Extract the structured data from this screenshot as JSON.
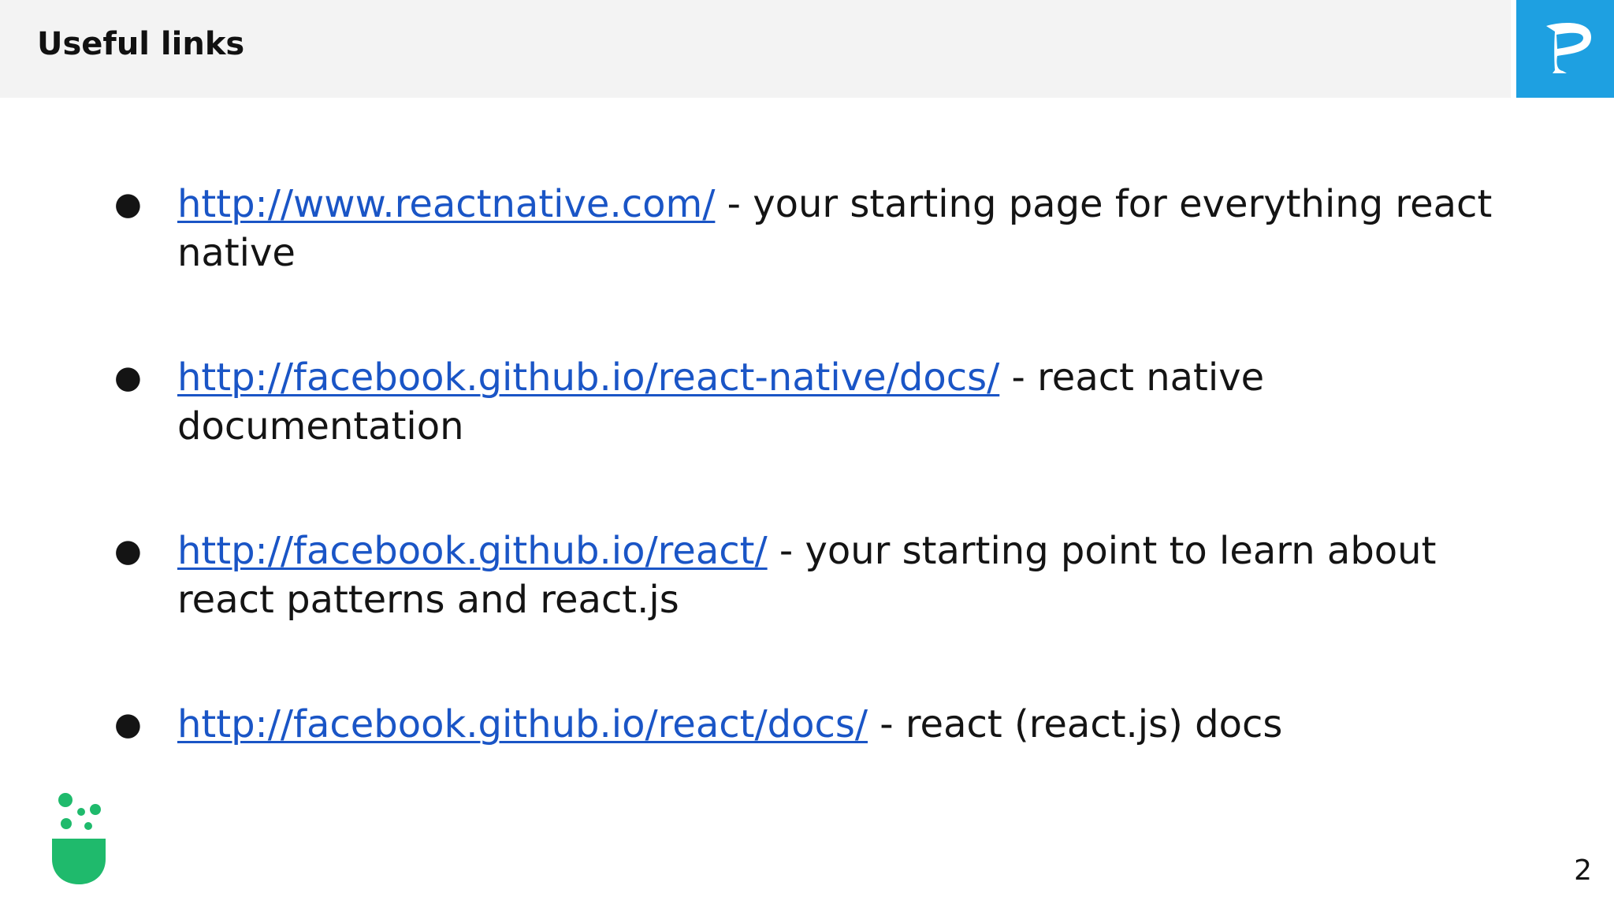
{
  "header": {
    "title": "Useful links",
    "background_color": "#f3f3f3"
  },
  "corner_logo": {
    "icon": "p-flag-logo-icon",
    "color": "#1ea0e1"
  },
  "links": [
    {
      "url": "http://www.reactnative.com/",
      "description": " - your starting page for everything react native"
    },
    {
      "url": "http://facebook.github.io/react-native/docs/",
      "description": " - react native documentation"
    },
    {
      "url": "http://facebook.github.io/react/",
      "description": " - your starting point to learn about react patterns and react.js"
    },
    {
      "url": "http://facebook.github.io/react/docs/",
      "description": " - react (react.js) docs"
    }
  ],
  "bullet_symbol": "●",
  "brand_icon": {
    "name": "green-flask-icon",
    "color": "#1fba6c"
  },
  "page_number": "2",
  "link_color": "#1a55c6"
}
